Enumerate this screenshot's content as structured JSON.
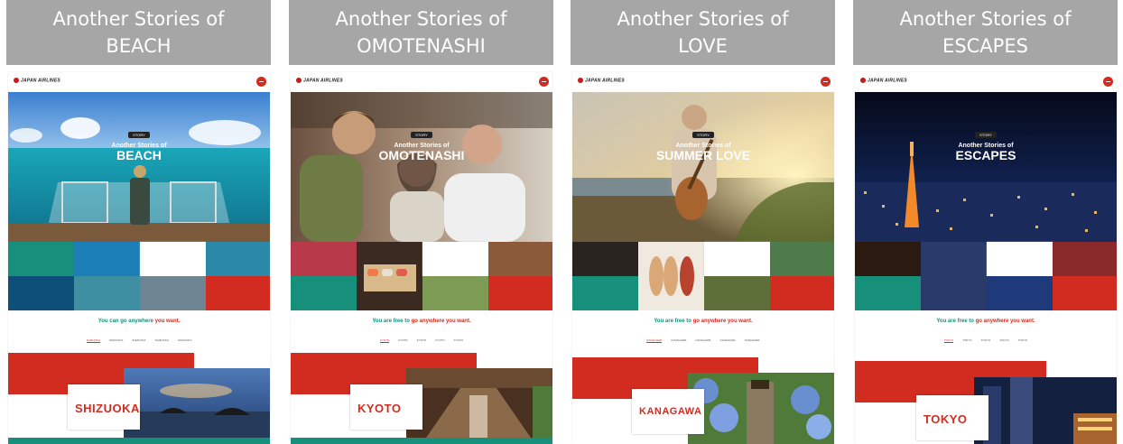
{
  "panels": [
    {
      "header_line1": "Another Stories of",
      "header_line2": "BEACH",
      "logo_text": "JAPAN AIRLINES",
      "hero_badge": "STORY",
      "hero_pre": "Another Stories of",
      "hero_title": "BEACH",
      "tagline_green": "You can go anywhere",
      "tagline_red": "you want.",
      "nav": [
        "SHIZUOKA",
        "SHIZUOKA",
        "SHIZUOKA",
        "SHIZUOKA",
        "SHIZUOKA"
      ],
      "destination": "SHIZUOKA"
    },
    {
      "header_line1": "Another Stories of",
      "header_line2": "OMOTENASHI",
      "logo_text": "JAPAN AIRLINES",
      "hero_badge": "STORY",
      "hero_pre": "Another Stories of",
      "hero_title": "OMOTENASHI",
      "tagline_green": "You are free to",
      "tagline_red": "go anywhere you want.",
      "nav": [
        "KYOTO",
        "KYOTO",
        "KYOTO",
        "KYOTO",
        "KYOTO"
      ],
      "destination": "KYOTO"
    },
    {
      "header_line1": "Another Stories of",
      "header_line2": "LOVE",
      "logo_text": "JAPAN AIRLINES",
      "hero_badge": "STORY",
      "hero_pre": "Another Stories of",
      "hero_title": "SUMMER LOVE",
      "tagline_green": "You are free to",
      "tagline_red": "go anywhere you want.",
      "nav": [
        "KANAGAWA",
        "KANAGAWA",
        "KANAGAWA",
        "KANAGAWA",
        "KANAGAWA"
      ],
      "destination": "KANAGAWA"
    },
    {
      "header_line1": "Another Stories of",
      "header_line2": "ESCAPES",
      "logo_text": "JAPAN AIRLINES",
      "hero_badge": "STORY",
      "hero_pre": "Another Stories of",
      "hero_title": "ESCAPES",
      "tagline_green": "You are free to",
      "tagline_red": "go anywhere you want.",
      "nav": [
        "TOKYO",
        "TOKYO",
        "TOKYO",
        "TOKYO",
        "TOKYO"
      ],
      "destination": "TOKYO"
    }
  ],
  "colors": {
    "header_gray": "#a6a6a6",
    "accent_red": "#d22c20",
    "accent_green": "#16907a"
  }
}
